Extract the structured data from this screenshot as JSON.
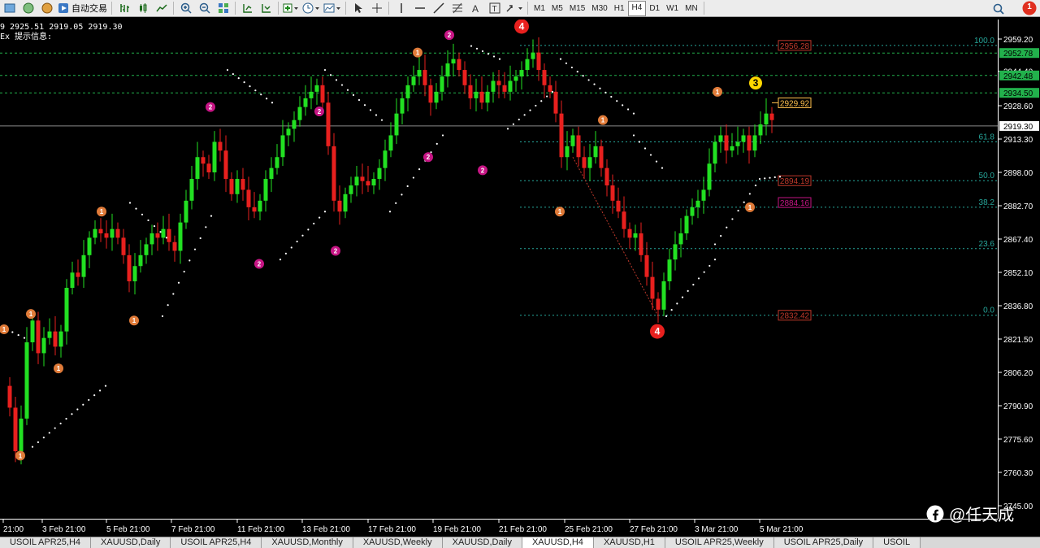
{
  "toolbar": {
    "auto_trading_label": "自动交易",
    "icons": [
      "new-order-icon",
      "market-watch-icon",
      "navigator-icon",
      "auto-trading-icon",
      "bar-chart-icon",
      "candlestick-icon",
      "line-chart-icon",
      "zoom-in-icon",
      "zoom-out-icon",
      "tile-windows-icon",
      "chart-shift-icon",
      "autoscroll-icon",
      "indicators-icon",
      "periods-icon",
      "templates-icon",
      "cursor-icon",
      "crosshair-icon",
      "vertical-line-icon",
      "horizontal-line-icon",
      "trendline-icon",
      "fibonacci-icon",
      "text-icon",
      "text-label-icon",
      "arrows-icon"
    ],
    "timeframes": [
      "M1",
      "M5",
      "M15",
      "M30",
      "H1",
      "H4",
      "D1",
      "W1",
      "MN"
    ],
    "active_timeframe": "H4",
    "notification_count": "1"
  },
  "chart": {
    "info_line1": "9 2925.51 2919.05 2919.30",
    "info_line2": "Ex 提示信息:",
    "price_levels": [
      "2959.20",
      "2944.40",
      "2928.60",
      "2913.30",
      "2898.00",
      "2882.70",
      "2867.40",
      "2852.10",
      "2836.80",
      "2821.50",
      "2806.20",
      "2790.90",
      "2775.60",
      "2760.30",
      "2745.00"
    ],
    "price_tags": [
      {
        "label": "2952.78",
        "color": "#22b14c",
        "price": 2952.78
      },
      {
        "label": "2942.48",
        "color": "#22b14c",
        "price": 2942.48
      },
      {
        "label": "2934.50",
        "color": "#22b14c",
        "price": 2934.5
      },
      {
        "label": "2919.30",
        "color": "#ffffff",
        "price": 2919.3
      }
    ],
    "fib_levels": [
      {
        "label": "100.0",
        "price": 2956.28
      },
      {
        "label": "61.8",
        "price": 2912.0
      },
      {
        "label": "50.0",
        "price": 2894.19
      },
      {
        "label": "38.2",
        "price": 2882.0
      },
      {
        "label": "23.6",
        "price": 2863.0
      },
      {
        "label": "0.0",
        "price": 2832.42
      }
    ],
    "level_boxes": [
      {
        "label": "2956.28",
        "color": "#c0392b",
        "price": 2956.28
      },
      {
        "label": "2929.92",
        "color": "#ffc04d",
        "price": 2929.92
      },
      {
        "label": "2894.19",
        "color": "#c0392b",
        "price": 2894.19
      },
      {
        "label": "2884.16",
        "color": "#c71585",
        "price": 2884.16
      },
      {
        "label": "2832.42",
        "color": "#c0392b",
        "price": 2832.42
      }
    ],
    "wave_labels": [
      {
        "text": "1",
        "color": "#e07b39"
      },
      {
        "text": "2",
        "color": "#c71585"
      },
      {
        "text": "3",
        "color": "#ffd700"
      },
      {
        "text": "4",
        "color": "#e8201e"
      }
    ],
    "colors": {
      "bull": "#22e022",
      "bear": "#e8201e",
      "background": "#000000",
      "grid": "#22b14c"
    }
  },
  "time_axis": [
    "21:00",
    "3 Feb 21:00",
    "5 Feb 21:00",
    "7 Feb 21:00",
    "11 Feb 21:00",
    "13 Feb 21:00",
    "17 Feb 21:00",
    "19 Feb 21:00",
    "21 Feb 21:00",
    "25 Feb 21:00",
    "27 Feb 21:00",
    "3 Mar 21:00",
    "5 Mar 21:00"
  ],
  "tabs": [
    "USOIL APR25,H4",
    "XAUUSD,Daily",
    "USOIL APR25,H4",
    "XAUUSD,Monthly",
    "XAUUSD,Weekly",
    "XAUUSD,Daily",
    "XAUUSD,H4",
    "XAUUSD,H1",
    "USOIL APR25,Weekly",
    "USOIL APR25,Daily",
    "USOIL"
  ],
  "active_tab_index": 6,
  "watermark": "@任天成"
}
